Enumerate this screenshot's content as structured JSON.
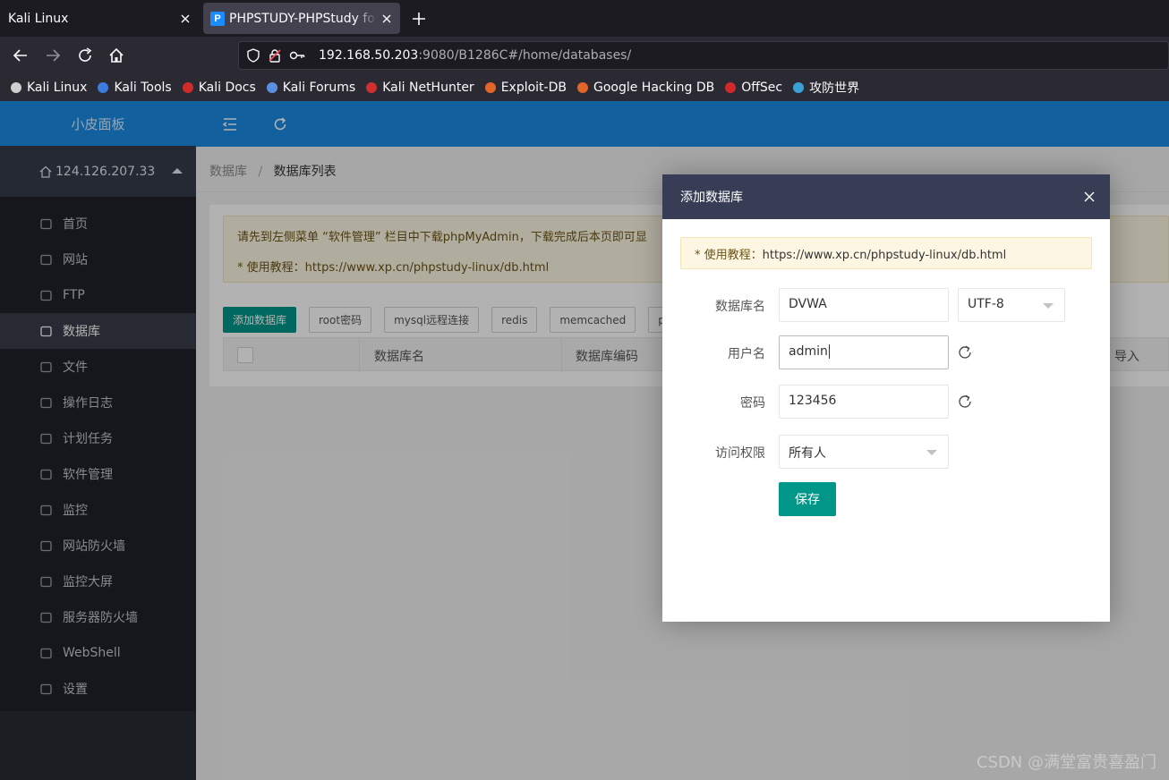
{
  "browser": {
    "tabs": [
      {
        "title": "Kali Linux",
        "active": false
      },
      {
        "title": "PHPSTUDY-PHPStudy for",
        "active": true,
        "favicon": "P"
      }
    ],
    "url": {
      "host": "192.168.50.203",
      "rest": ":9080/B1286C#/home/databases/"
    },
    "bookmarks": [
      {
        "label": "Kali Linux",
        "icon": "kali-dragon-icon"
      },
      {
        "label": "Kali Tools",
        "icon": "kali-tools-icon"
      },
      {
        "label": "Kali Docs",
        "icon": "kali-docs-icon"
      },
      {
        "label": "Kali Forums",
        "icon": "kali-forums-icon"
      },
      {
        "label": "Kali NetHunter",
        "icon": "nethunter-icon"
      },
      {
        "label": "Exploit-DB",
        "icon": "exploit-db-icon"
      },
      {
        "label": "Google Hacking DB",
        "icon": "ghdb-icon"
      },
      {
        "label": "OffSec",
        "icon": "offsec-icon"
      },
      {
        "label": "攻防世界",
        "icon": "globe-icon"
      }
    ]
  },
  "sidebar": {
    "logo": "小皮面板",
    "server": "124.126.207.33",
    "items": [
      {
        "label": "首页",
        "icon": "home-icon"
      },
      {
        "label": "网站",
        "icon": "monitor-icon"
      },
      {
        "label": "FTP",
        "icon": "ftp-icon"
      },
      {
        "label": "数据库",
        "icon": "database-icon",
        "active": true
      },
      {
        "label": "文件",
        "icon": "folder-icon"
      },
      {
        "label": "操作日志",
        "icon": "layers-icon"
      },
      {
        "label": "计划任务",
        "icon": "clock-icon"
      },
      {
        "label": "软件管理",
        "icon": "download-icon"
      },
      {
        "label": "监控",
        "icon": "chart-icon"
      },
      {
        "label": "网站防火墙",
        "icon": "shield-icon"
      },
      {
        "label": "监控大屏",
        "icon": "screen-icon"
      },
      {
        "label": "服务器防火墙",
        "icon": "shield-half-icon"
      },
      {
        "label": "WebShell",
        "icon": "terminal-icon"
      },
      {
        "label": "设置",
        "icon": "gear-icon"
      }
    ]
  },
  "breadcrumb": {
    "parent": "数据库",
    "sep": "/",
    "current": "数据库列表"
  },
  "notice": {
    "line1": "请先到左侧菜单 “软件管理” 栏目中下载phpMyAdmin，下载完成后本页即可显",
    "line2": "* 使用教程：https://www.xp.cn/phpstudy-linux/db.html"
  },
  "toolbar": {
    "buttons": [
      "添加数据库",
      "root密码",
      "mysql远程连接",
      "redis",
      "memcached",
      "phpM"
    ]
  },
  "table": {
    "columns": [
      "数据库名",
      "数据库编码",
      "导入"
    ]
  },
  "modal": {
    "title": "添加数据库",
    "notice_prefix": "* 使用教程：",
    "notice_link": "https://www.xp.cn/phpstudy-linux/db.html",
    "fields": {
      "dbname_label": "数据库名",
      "dbname_value": "DVWA",
      "charset_value": "UTF-8",
      "user_label": "用户名",
      "user_value": "admin",
      "password_label": "密码",
      "password_value": "123456",
      "access_label": "访问权限",
      "access_value": "所有人"
    },
    "save": "保存"
  },
  "watermark": "CSDN @满堂富贵喜盈门",
  "colors": {
    "primary_blue": "#1c8ae3",
    "teal": "#009688",
    "sidebar": "#1f2229",
    "modal_header": "#363d54"
  }
}
